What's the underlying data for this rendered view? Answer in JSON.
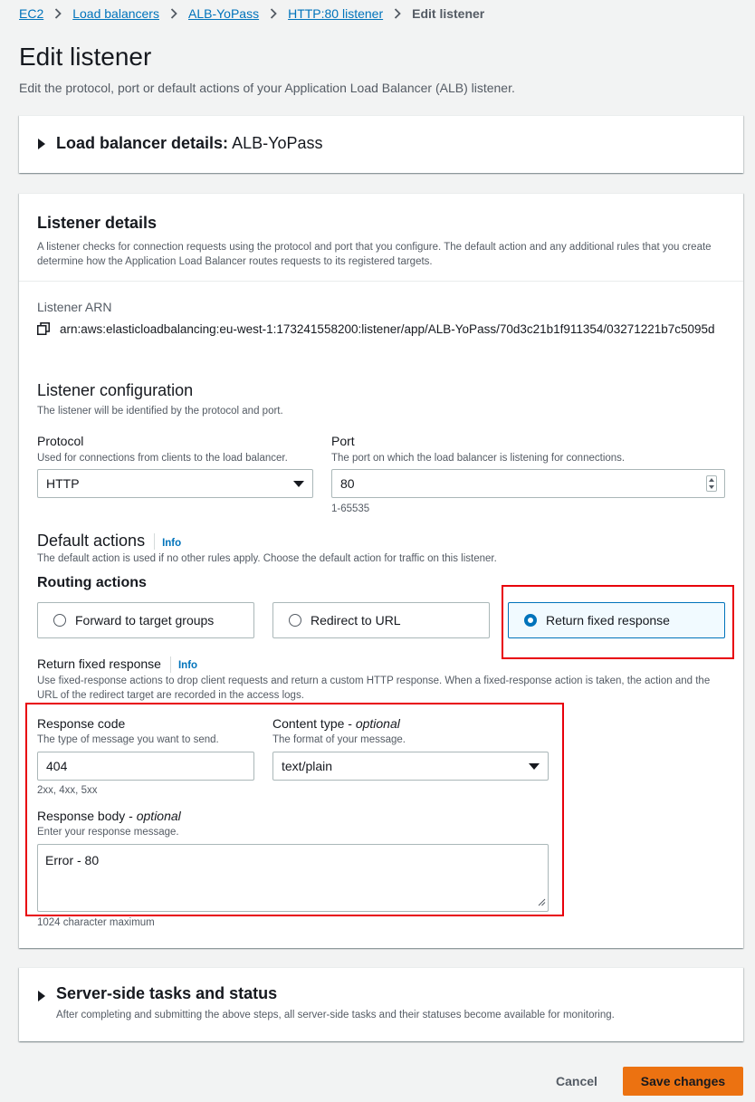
{
  "breadcrumb": {
    "items": [
      "EC2",
      "Load balancers",
      "ALB-YoPass",
      "HTTP:80 listener"
    ],
    "current": "Edit listener"
  },
  "page": {
    "title": "Edit listener",
    "description": "Edit the protocol, port or default actions of your Application Load Balancer (ALB) listener."
  },
  "lb_details": {
    "label": "Load balancer details:",
    "value": "ALB-YoPass"
  },
  "listener_details": {
    "title": "Listener details",
    "description": "A listener checks for connection requests using the protocol and port that you configure. The default action and any additional rules that you create determine how the Application Load Balancer routes requests to its registered targets.",
    "arn_label": "Listener ARN",
    "arn_value": "arn:aws:elasticloadbalancing:eu-west-1:173241558200:listener/app/ALB-YoPass/70d3c21b1f911354/03271221b7c5095d"
  },
  "listener_config": {
    "title": "Listener configuration",
    "description": "The listener will be identified by the protocol and port.",
    "protocol_label": "Protocol",
    "protocol_desc": "Used for connections from clients to the load balancer.",
    "protocol_value": "HTTP",
    "port_label": "Port",
    "port_desc": "The port on which the load balancer is listening for connections.",
    "port_value": "80",
    "port_hint": "1-65535"
  },
  "default_actions": {
    "title": "Default actions",
    "info": "Info",
    "description": "The default action is used if no other rules apply. Choose the default action for traffic on this listener.",
    "routing_title": "Routing actions",
    "options": [
      {
        "label": "Forward to target groups",
        "selected": false
      },
      {
        "label": "Redirect to URL",
        "selected": false
      },
      {
        "label": "Return fixed response",
        "selected": true
      }
    ]
  },
  "fixed_response": {
    "title": "Return fixed response",
    "info": "Info",
    "description": "Use fixed-response actions to drop client requests and return a custom HTTP response. When a fixed-response action is taken, the action and the URL of the redirect target are recorded in the access logs.",
    "response_code_label": "Response code",
    "response_code_desc": "The type of message you want to send.",
    "response_code_value": "404",
    "response_code_hint": "2xx, 4xx, 5xx",
    "content_type_label": "Content type - ",
    "content_type_optional": "optional",
    "content_type_desc": "The format of your message.",
    "content_type_value": "text/plain",
    "body_label": "Response body - ",
    "body_optional": "optional",
    "body_desc": "Enter your response message.",
    "body_value": "Error - 80",
    "body_hint": "1024 character maximum"
  },
  "server_side": {
    "title": "Server-side tasks and status",
    "description": "After completing and submitting the above steps, all server-side tasks and their statuses become available for monitoring."
  },
  "actions": {
    "cancel": "Cancel",
    "save": "Save changes"
  },
  "colors": {
    "link": "#0073bb",
    "primary_button": "#ec7211",
    "highlight": "#e8000b",
    "selected_tile": "#f1faff"
  }
}
